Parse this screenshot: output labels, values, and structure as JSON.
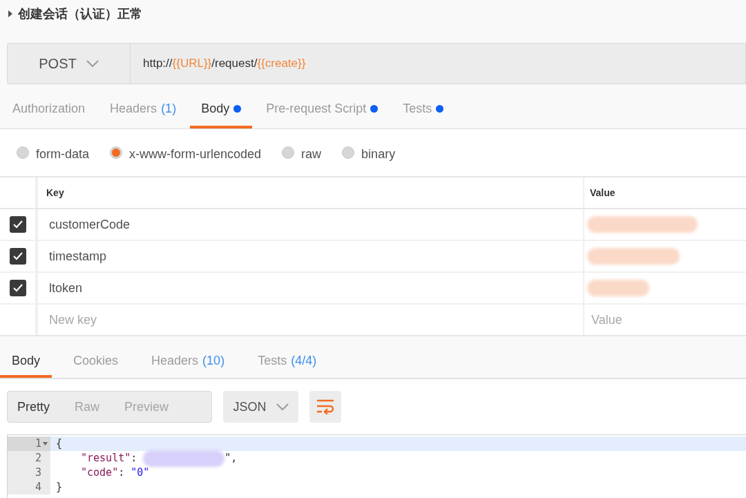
{
  "request_name": "创建会话（认证）正常",
  "method": "POST",
  "url": [
    {
      "kind": "plain",
      "text": "http://"
    },
    {
      "kind": "var",
      "text": "{{URL}}"
    },
    {
      "kind": "plain",
      "text": "/request/"
    },
    {
      "kind": "var",
      "text": "{{create}}"
    }
  ],
  "request_tabs": [
    {
      "label": "Authorization",
      "selected": false,
      "dot": false
    },
    {
      "label": "Headers",
      "count": "(1)",
      "selected": false,
      "dot": false
    },
    {
      "label": "Body",
      "selected": true,
      "dot": true
    },
    {
      "label": "Pre-request Script",
      "selected": false,
      "dot": true
    },
    {
      "label": "Tests",
      "selected": false,
      "dot": true
    }
  ],
  "body_types": [
    {
      "label": "form-data",
      "selected": false
    },
    {
      "label": "x-www-form-urlencoded",
      "selected": true
    },
    {
      "label": "raw",
      "selected": false
    },
    {
      "label": "binary",
      "selected": false
    }
  ],
  "params": {
    "columns": [
      "Key",
      "Value"
    ],
    "rows": [
      {
        "checked": true,
        "key": "customerCode",
        "value_redacted": true
      },
      {
        "checked": true,
        "key": "timestamp",
        "value_redacted": true
      },
      {
        "checked": true,
        "key": "ltoken",
        "value_redacted": true
      }
    ],
    "new_row": {
      "key_placeholder": "New key",
      "value_placeholder": "Value"
    }
  },
  "response_tabs": [
    {
      "label": "Body",
      "selected": true
    },
    {
      "label": "Cookies",
      "selected": false
    },
    {
      "label": "Headers",
      "count": "(10)",
      "selected": false
    },
    {
      "label": "Tests",
      "count": "(4/4)",
      "selected": false
    }
  ],
  "view_modes": [
    {
      "label": "Pretty",
      "selected": true
    },
    {
      "label": "Raw",
      "selected": false
    },
    {
      "label": "Preview",
      "selected": false
    }
  ],
  "format": "JSON",
  "code_lines": [
    {
      "number": "1",
      "fold": true,
      "highlighted": true,
      "tokens": [
        {
          "kind": "punct",
          "text": "{"
        }
      ]
    },
    {
      "number": "2",
      "fold": false,
      "highlighted": false,
      "tokens": [
        {
          "kind": "key",
          "text": "\"result\""
        },
        {
          "kind": "punct",
          "text": ": "
        },
        {
          "kind": "redacted"
        },
        {
          "kind": "punct",
          "text": "\","
        }
      ]
    },
    {
      "number": "3",
      "fold": false,
      "highlighted": false,
      "tokens": [
        {
          "kind": "key",
          "text": "\"code\""
        },
        {
          "kind": "punct",
          "text": ": "
        },
        {
          "kind": "string",
          "text": "\"0\""
        }
      ]
    },
    {
      "number": "4",
      "fold": false,
      "highlighted": false,
      "tokens": [
        {
          "kind": "punct",
          "text": "}"
        }
      ]
    }
  ]
}
